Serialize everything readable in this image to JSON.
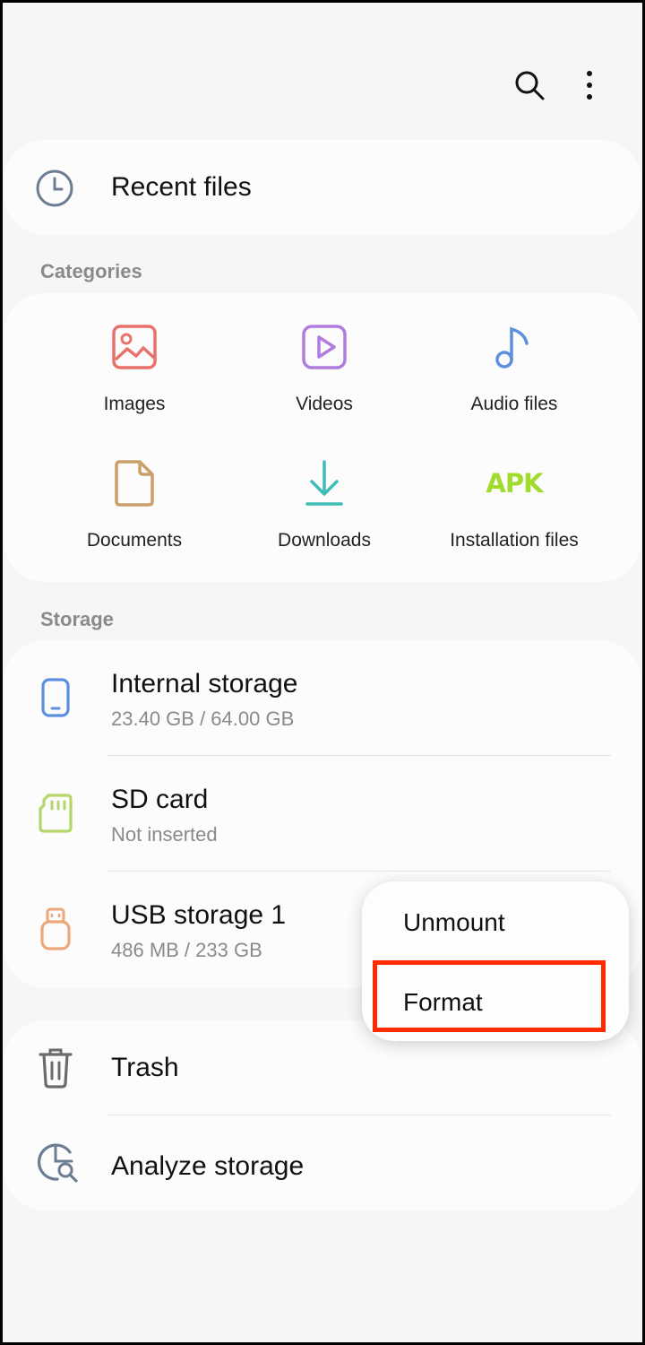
{
  "toolbar": {
    "search_icon": "search-icon",
    "more_icon": "more-vert-icon"
  },
  "recent": {
    "label": "Recent files",
    "icon": "clock-icon"
  },
  "categories": {
    "header": "Categories",
    "items": [
      {
        "label": "Images",
        "icon": "image-icon",
        "color": "#e8726a"
      },
      {
        "label": "Videos",
        "icon": "video-icon",
        "color": "#b27be0"
      },
      {
        "label": "Audio files",
        "icon": "music-note-icon",
        "color": "#5d8fe0"
      },
      {
        "label": "Documents",
        "icon": "document-icon",
        "color": "#c9a06a"
      },
      {
        "label": "Downloads",
        "icon": "download-icon",
        "color": "#3dbdb6"
      },
      {
        "label": "Installation files",
        "icon_text": "APK",
        "icon": "apk-icon",
        "color": "#9fdc2c"
      }
    ]
  },
  "storage": {
    "header": "Storage",
    "items": [
      {
        "title": "Internal storage",
        "sub": "23.40 GB / 64.00 GB",
        "icon": "phone-icon",
        "color": "#5d8fe0"
      },
      {
        "title": "SD card",
        "sub": "Not inserted",
        "icon": "sd-card-icon",
        "color": "#b5d66a"
      },
      {
        "title": "USB storage 1",
        "sub": "486 MB / 233 GB",
        "icon": "usb-icon",
        "color": "#eea678"
      }
    ]
  },
  "tools": {
    "items": [
      {
        "title": "Trash",
        "icon": "trash-icon"
      },
      {
        "title": "Analyze storage",
        "icon": "analyze-storage-icon"
      }
    ]
  },
  "popup_menu": {
    "items": [
      {
        "label": "Unmount"
      },
      {
        "label": "Format"
      }
    ],
    "highlight_color": "#ff2a00"
  }
}
